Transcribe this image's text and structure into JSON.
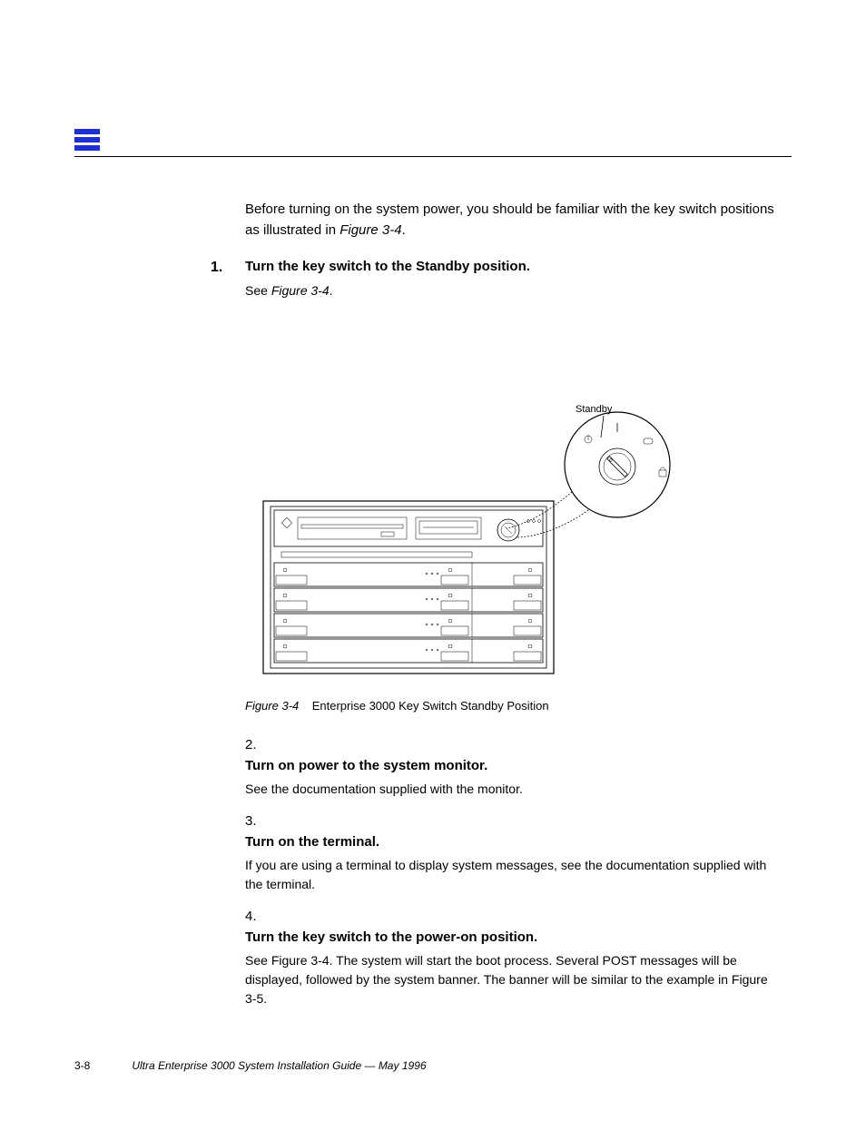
{
  "header": {
    "chapter_marker": "3"
  },
  "intro": {
    "para1_prefix": "Before turning on the system power, you should be familiar with the key switch positions as illustrated in ",
    "figref1": "Figure 3-4",
    "para1_suffix": "."
  },
  "steps": [
    {
      "num": "1.",
      "title": "Turn the key switch to the Standby position.",
      "desc_prefix": "See ",
      "desc_ref": "Figure 3-4",
      "desc_suffix": "."
    },
    {
      "num": "2.",
      "title": "Turn on power to the system monitor.",
      "desc": "See the documentation supplied with the monitor."
    },
    {
      "num": "3.",
      "title": "Turn on the terminal.",
      "desc": "If you are using a terminal to display system messages, see the documentation supplied with the terminal."
    },
    {
      "num": "4.",
      "title": "Turn the key switch to the power-on position.",
      "desc_prefix": "See ",
      "desc_ref": "Figure 3-4",
      "desc_suffix_a": ". The system will start the boot process. Several POST messages will be displayed, followed by the system banner. The banner will be similar to the example in ",
      "desc_ref_b": "Figure 3-5",
      "desc_suffix_b": "."
    }
  ],
  "figure": {
    "label_standby": "Standby",
    "caption_num": "Figure 3-4",
    "caption_text": "Enterprise 3000 Key Switch Standby Position"
  },
  "footer": {
    "page": "3-8",
    "title": "Ultra Enterprise 3000 System Installation Guide",
    "date": "May 1996"
  }
}
